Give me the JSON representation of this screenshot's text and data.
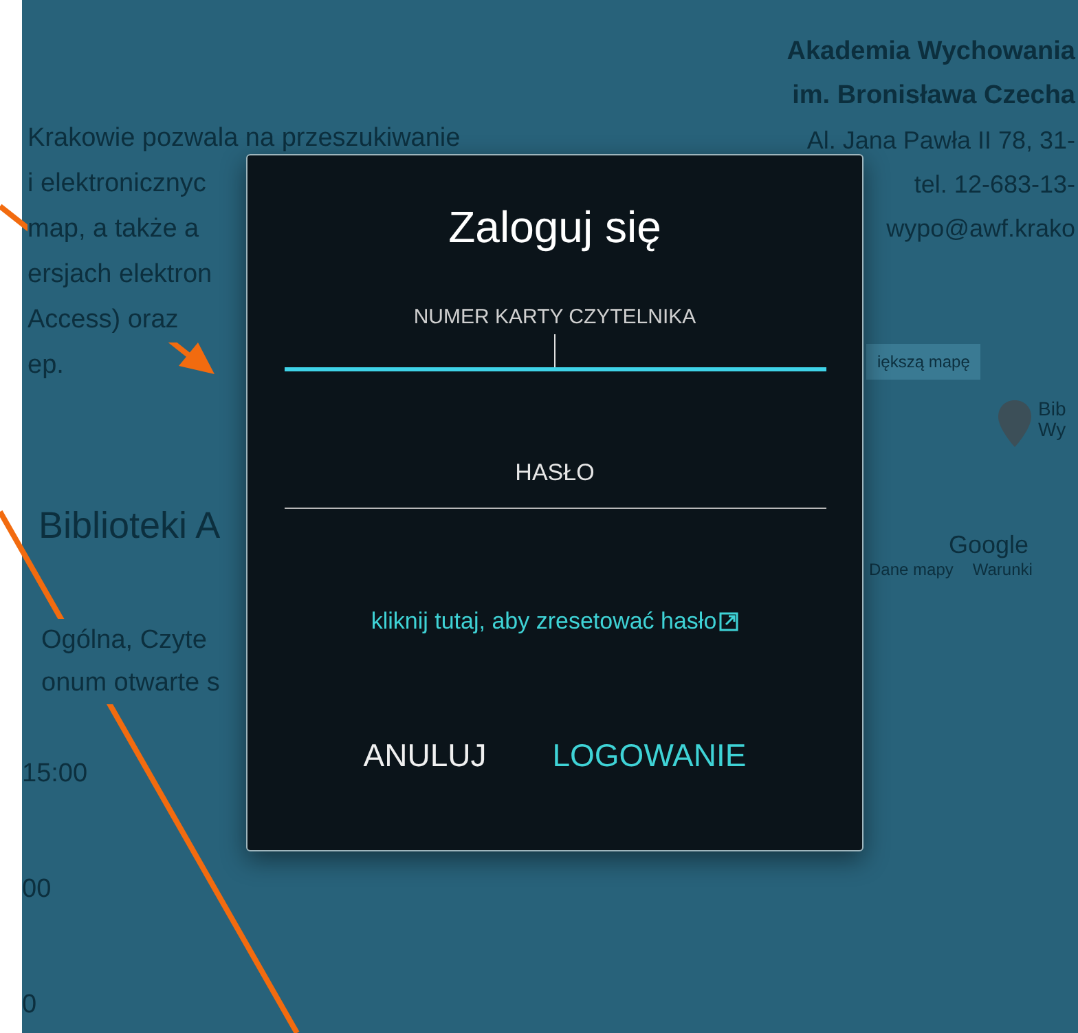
{
  "page": {
    "left_blocks": [
      {
        "kind": "paragraph",
        "lines": [
          "Krakowie pozwala na przeszukiwanie",
          "i elektronicznyc",
          "map, a także a",
          "ersjach elektron",
          "Access) oraz",
          "ep."
        ]
      },
      {
        "kind": "heading",
        "lines": [
          "Biblioteki A"
        ]
      },
      {
        "kind": "paragraph",
        "lines": [
          "Ogólna, Czyte",
          "onum otwarte s"
        ]
      },
      {
        "kind": "hours",
        "lines": [
          "15:00",
          "00",
          "0"
        ]
      }
    ],
    "contact": [
      {
        "text": "Akademia Wychowania",
        "bold": true
      },
      {
        "text": "im. Bronisława Czecha",
        "bold": true
      },
      {
        "text": "Al. Jana Pawła II 78, 31-",
        "bold": false
      },
      {
        "text": "tel. 12-683-13-",
        "bold": false
      },
      {
        "text": "wypo@awf.krako",
        "bold": false
      }
    ],
    "map": {
      "link": "iększą mapę",
      "pin_label": [
        "Bib",
        "Wy"
      ],
      "logo": "Google",
      "footer": [
        "Dane mapy",
        "Warunki"
      ]
    }
  },
  "dialog": {
    "title": "Zaloguj się",
    "fields": [
      {
        "label": "NUMER KARTY CZYTELNIKA",
        "focused": true
      },
      {
        "label": "HASŁO",
        "focused": false
      }
    ],
    "reset_link": "kliknij tutaj, aby zresetować hasło",
    "buttons": [
      {
        "label": "ANULUJ",
        "kind": "cancel"
      },
      {
        "label": "LOGOWANIE",
        "kind": "primary"
      }
    ]
  }
}
